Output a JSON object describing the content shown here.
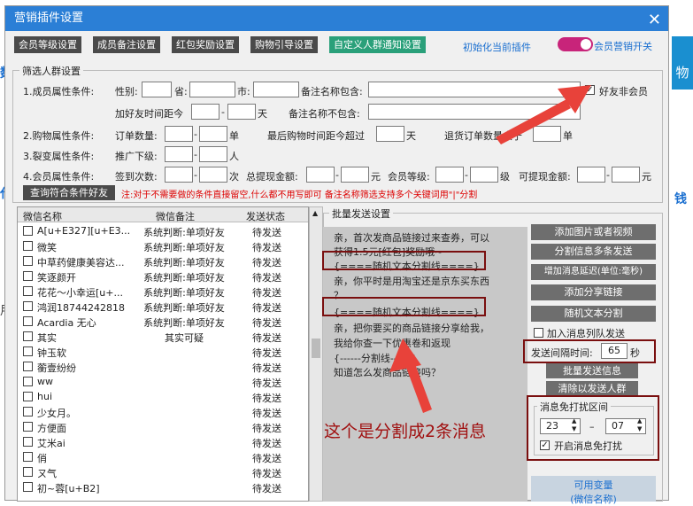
{
  "window": {
    "title": "营销插件设置",
    "close": "✕"
  },
  "toolbar": {
    "tabs": [
      "会员等级设置",
      "成员备注设置",
      "红包奖励设置",
      "购物引导设置",
      "自定义人群通知设置"
    ],
    "init_link": "初始化当前插件",
    "toggle_label": "会员营销开关"
  },
  "filter": {
    "title": "筛选人群设置",
    "row1": {
      "label": "1.成员属性条件:",
      "gender": "性别:",
      "province": "省:",
      "city": "市:",
      "note_include": "备注名称包含:",
      "friend_not_member": "好友非会员",
      "friend_time": "加好友时间距今",
      "dash": "-",
      "day": "天",
      "note_exclude": "备注名称不包含:"
    },
    "row2": {
      "label": "2.购物属性条件:",
      "order_count": "订单数量:",
      "dash": "-",
      "unit": "单",
      "last_buy": "最后购物时间距今超过",
      "day": "天",
      "refund": "退货订单数量大于",
      "unit2": "单"
    },
    "row3": {
      "label": "3.裂变属性条件:",
      "promo": "推广下级:",
      "dash": "-",
      "unit": "人"
    },
    "row4": {
      "label": "4.会员属性条件:",
      "sign": "签到次数:",
      "dash": "-",
      "times": "次",
      "withdraw_total": "总提现金额:",
      "yuan": "元",
      "level": "会员等级:",
      "grade": "级",
      "withdrawable": "可提现金额:",
      "yuan2": "元"
    },
    "query_button": "查询符合条件好友",
    "note": "注:对于不需要做的条件直接留空,什么都不用写即可 备注名称筛选支持多个关键词用\"|\"分割"
  },
  "table": {
    "headers": [
      "微信名称",
      "微信备注",
      "发送状态"
    ],
    "rows": [
      {
        "name": "A[u+E327][u+E3...",
        "note": "系统判断:单项好友",
        "status": "待发送"
      },
      {
        "name": "微笑",
        "note": "系统判断:单项好友",
        "status": "待发送"
      },
      {
        "name": "中草药健康美容达...",
        "note": "系统判断:单项好友",
        "status": "待发送"
      },
      {
        "name": "笑逐颜开",
        "note": "系统判断:单项好友",
        "status": "待发送"
      },
      {
        "name": "花花～小幸运[u+...",
        "note": "系统判断:单项好友",
        "status": "待发送"
      },
      {
        "name": "鸿润18744242818",
        "note": "系统判断:单项好友",
        "status": "待发送"
      },
      {
        "name": "Acardia 无心",
        "note": "系统判断:单项好友",
        "status": "待发送"
      },
      {
        "name": "其实",
        "note": "其实可疑",
        "status": "待发送"
      },
      {
        "name": "钟玉软",
        "note": "",
        "status": "待发送"
      },
      {
        "name": "蘅壹纷纷",
        "note": "",
        "status": "待发送"
      },
      {
        "name": "ww",
        "note": "",
        "status": "待发送"
      },
      {
        "name": "hui",
        "note": "",
        "status": "待发送"
      },
      {
        "name": "少女月。",
        "note": "",
        "status": "待发送"
      },
      {
        "name": "方便面",
        "note": "",
        "status": "待发送"
      },
      {
        "name": "艾米ai",
        "note": "",
        "status": "待发送"
      },
      {
        "name": "俏",
        "note": "",
        "status": "待发送"
      },
      {
        "name": "ㄡ气",
        "note": "",
        "status": "待发送"
      },
      {
        "name": "初~蓉[u+B2]",
        "note": "",
        "status": "待发送"
      }
    ]
  },
  "batch": {
    "title": "批量发送设置",
    "lines": [
      "亲，首次发商品链接过来查券，可以",
      "获得1.5元[红包]奖励哦~",
      "{====随机文本分割线====}",
      "亲，你平时是用淘宝还是京东买东西",
      "？",
      "{====随机文本分割线====}",
      "亲，把你要买的商品链接分享给我，",
      "我给你查一下优惠卷和返现",
      "{------分割线------}",
      "知道怎么发商品链接吗？"
    ],
    "buttons": [
      "添加图片或者视频",
      "分割信息多条发送",
      "增加消息延迟(单位:毫秒)",
      "添加分享链接",
      "随机文本分割"
    ],
    "queue_label": "加入消息列队发送",
    "interval_label": "发送间隔时间:",
    "interval_value": "65",
    "interval_unit": "秒",
    "send_button": "批量发送信息",
    "clear_button": "清除以发送人群",
    "dnd_title": "消息免打扰区间",
    "dnd_from": "23",
    "dnd_to": "07",
    "dnd_dash": "–",
    "dnd_enable": "开启消息免打扰",
    "vars_line1": "可用变量",
    "vars_line2": "(微信名称)"
  },
  "annotation": "这个是分割成2条消息",
  "side": {
    "top_char": "物",
    "left_char1": "数",
    "left_char2": "代",
    "left_char3": "用",
    "right_char": "钱"
  }
}
